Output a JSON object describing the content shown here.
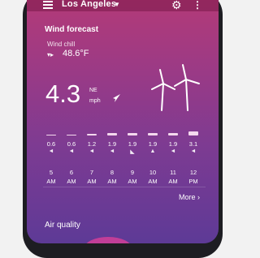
{
  "header": {
    "city": "Los Angeles",
    "menu_icon": "menu-icon",
    "dropdown_icon": "chevron-down-icon",
    "settings_icon": "gear-icon",
    "more_icon": "more-vert-icon"
  },
  "wind": {
    "title": "Wind forecast",
    "wind_chill_label": "Wind chill",
    "wind_chill_value": "48.6°F",
    "speed": "4.3",
    "direction": "NE",
    "unit": "mph"
  },
  "hourly": [
    {
      "time": "5",
      "ampm": "AM",
      "value": "0.6",
      "arrow": "◄"
    },
    {
      "time": "6",
      "ampm": "AM",
      "value": "0.6",
      "arrow": "◄"
    },
    {
      "time": "7",
      "ampm": "AM",
      "value": "1.2",
      "arrow": "◄"
    },
    {
      "time": "8",
      "ampm": "AM",
      "value": "1.9",
      "arrow": "◄"
    },
    {
      "time": "9",
      "ampm": "AM",
      "value": "1.9",
      "arrow": "◣"
    },
    {
      "time": "10",
      "ampm": "AM",
      "value": "1.9",
      "arrow": "▲"
    },
    {
      "time": "11",
      "ampm": "AM",
      "value": "1.9",
      "arrow": "◄"
    },
    {
      "time": "12",
      "ampm": "PM",
      "value": "3.1",
      "arrow": "◄"
    }
  ],
  "more_label": "More",
  "air_quality_title": "Air quality",
  "colors": {
    "accent": "#b33a78",
    "deep": "#5d3a96"
  }
}
